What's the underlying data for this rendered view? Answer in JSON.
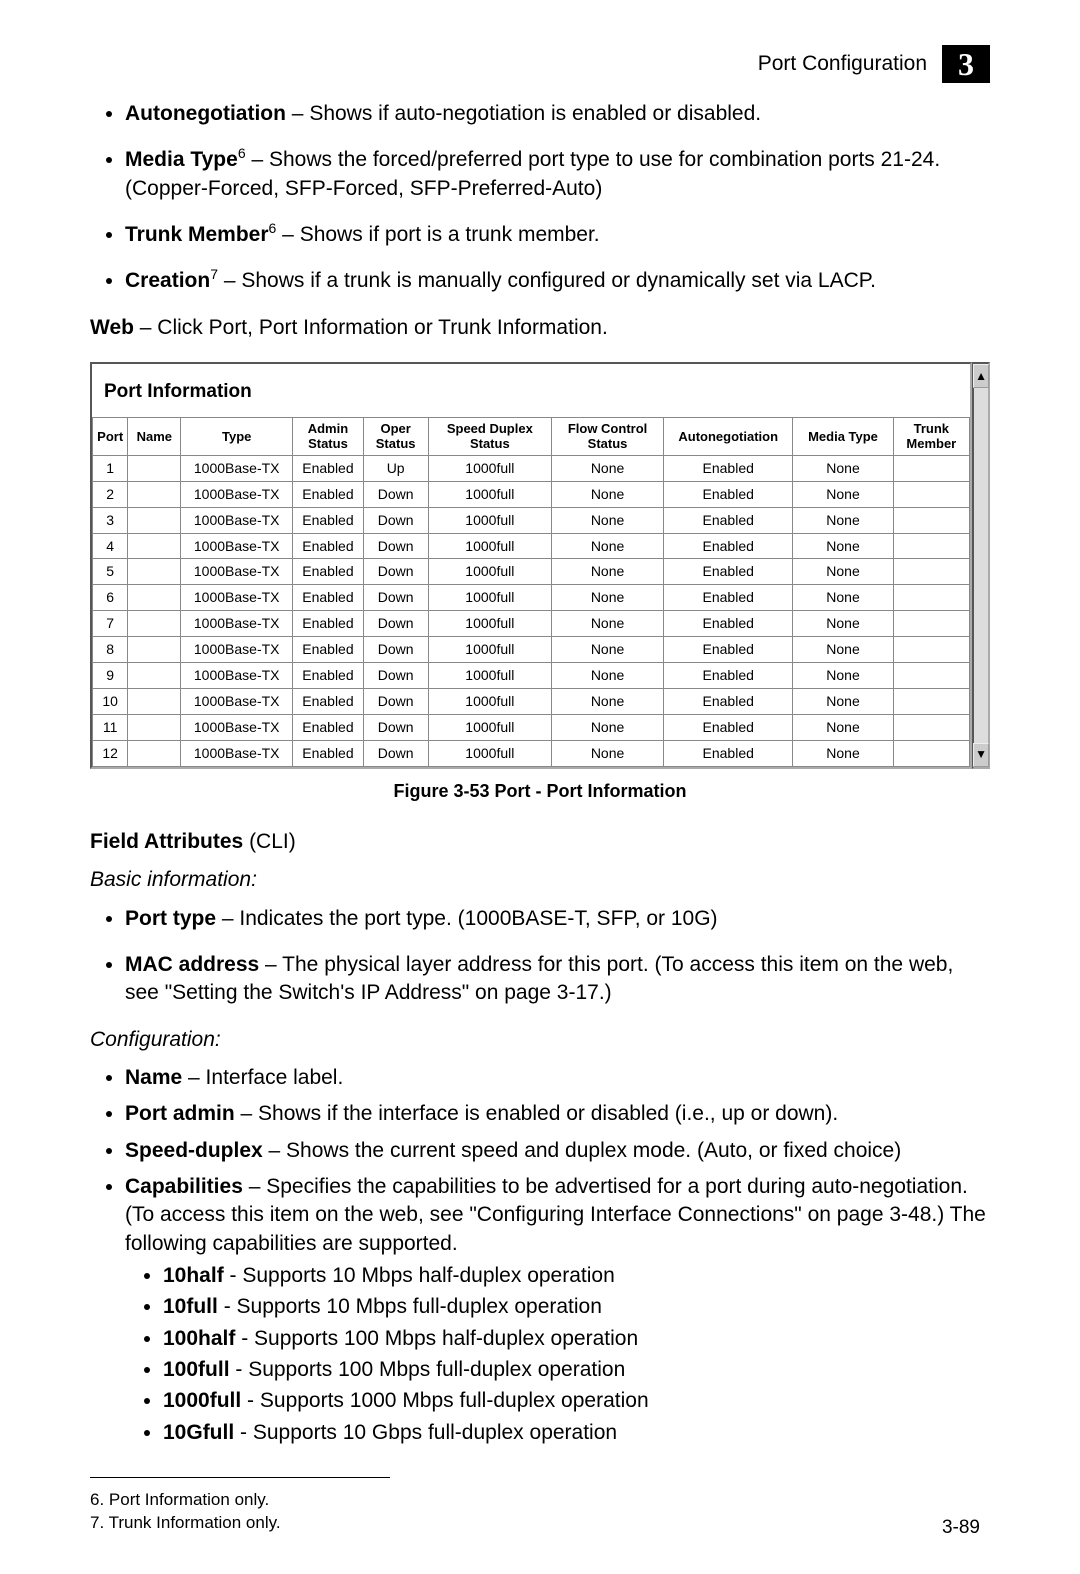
{
  "chapter": {
    "title": "Port Configuration",
    "number": "3"
  },
  "intro_bullets": [
    {
      "term": "Autonegotiation",
      "sup": "",
      "desc": " – Shows if auto-negotiation is enabled or disabled."
    },
    {
      "term": "Media Type",
      "sup": "6",
      "desc": " – Shows the forced/preferred port type to use for combination ports 21-24. (Copper-Forced, SFP-Forced, SFP-Preferred-Auto)"
    },
    {
      "term": "Trunk Member",
      "sup": "6",
      "desc": " – Shows if port is a trunk member."
    },
    {
      "term": "Creation",
      "sup": "7",
      "desc": " – Shows if a trunk is manually configured or dynamically set via LACP."
    }
  ],
  "web_line": {
    "label": "Web",
    "desc": " – Click Port, Port Information or Trunk Information."
  },
  "panel": {
    "title": "Port Information",
    "columns": [
      "Port",
      "Name",
      "Type",
      "Admin Status",
      "Oper Status",
      "Speed Duplex Status",
      "Flow Control Status",
      "Autonegotiation",
      "Media Type",
      "Trunk Member"
    ],
    "rows": [
      [
        "1",
        "",
        "1000Base-TX",
        "Enabled",
        "Up",
        "1000full",
        "None",
        "Enabled",
        "None",
        ""
      ],
      [
        "2",
        "",
        "1000Base-TX",
        "Enabled",
        "Down",
        "1000full",
        "None",
        "Enabled",
        "None",
        ""
      ],
      [
        "3",
        "",
        "1000Base-TX",
        "Enabled",
        "Down",
        "1000full",
        "None",
        "Enabled",
        "None",
        ""
      ],
      [
        "4",
        "",
        "1000Base-TX",
        "Enabled",
        "Down",
        "1000full",
        "None",
        "Enabled",
        "None",
        ""
      ],
      [
        "5",
        "",
        "1000Base-TX",
        "Enabled",
        "Down",
        "1000full",
        "None",
        "Enabled",
        "None",
        ""
      ],
      [
        "6",
        "",
        "1000Base-TX",
        "Enabled",
        "Down",
        "1000full",
        "None",
        "Enabled",
        "None",
        ""
      ],
      [
        "7",
        "",
        "1000Base-TX",
        "Enabled",
        "Down",
        "1000full",
        "None",
        "Enabled",
        "None",
        ""
      ],
      [
        "8",
        "",
        "1000Base-TX",
        "Enabled",
        "Down",
        "1000full",
        "None",
        "Enabled",
        "None",
        ""
      ],
      [
        "9",
        "",
        "1000Base-TX",
        "Enabled",
        "Down",
        "1000full",
        "None",
        "Enabled",
        "None",
        ""
      ],
      [
        "10",
        "",
        "1000Base-TX",
        "Enabled",
        "Down",
        "1000full",
        "None",
        "Enabled",
        "None",
        ""
      ],
      [
        "11",
        "",
        "1000Base-TX",
        "Enabled",
        "Down",
        "1000full",
        "None",
        "Enabled",
        "None",
        ""
      ],
      [
        "12",
        "",
        "1000Base-TX",
        "Enabled",
        "Down",
        "1000full",
        "None",
        "Enabled",
        "None",
        ""
      ]
    ]
  },
  "figure_caption": "Figure 3-53   Port - Port Information",
  "field_attr": {
    "label": "Field Attributes",
    "paren": " (CLI)"
  },
  "basic_header": "Basic information:",
  "basic_bullets": [
    {
      "term": "Port type",
      "desc": " – Indicates the port type. (1000BASE-T, SFP, or 10G)"
    },
    {
      "term": "MAC address",
      "desc": " – The physical layer address for this port. (To access this item on the web, see \"Setting the Switch's IP Address\" on page 3-17.)"
    }
  ],
  "config_header": "Configuration:",
  "config_bullets": [
    {
      "term": "Name",
      "desc": " – Interface label."
    },
    {
      "term": "Port admin",
      "desc": " – Shows if the interface is enabled or disabled (i.e., up or down)."
    },
    {
      "term": "Speed-duplex",
      "desc": " – Shows the current speed and duplex mode. (Auto, or fixed choice)"
    },
    {
      "term": "Capabilities",
      "desc": " – Specifies the capabilities to be advertised for a port during auto-negotiation. (To access this item on the web, see \"Configuring Interface Connections\" on page 3-48.) The following capabilities are supported."
    }
  ],
  "capabilities": [
    {
      "term": "10half",
      "desc": " - Supports 10 Mbps half-duplex operation"
    },
    {
      "term": "10full",
      "desc": " - Supports 10 Mbps full-duplex operation"
    },
    {
      "term": "100half",
      "desc": " - Supports 100 Mbps half-duplex operation"
    },
    {
      "term": "100full",
      "desc": " - Supports 100 Mbps full-duplex operation"
    },
    {
      "term": "1000full",
      "desc": " - Supports 1000 Mbps full-duplex operation"
    },
    {
      "term": "10Gfull",
      "desc": " - Supports 10 Gbps full-duplex operation"
    }
  ],
  "footnotes": [
    "6.  Port Information only.",
    "7.  Trunk Information only."
  ],
  "page_number": "3-89",
  "col_widths": [
    "30",
    "45",
    "95",
    "60",
    "55",
    "105",
    "95",
    "110",
    "85",
    "65"
  ]
}
